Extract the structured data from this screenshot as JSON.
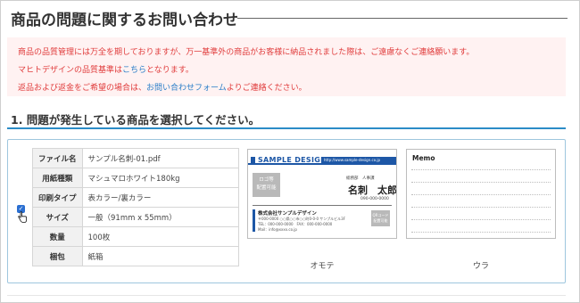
{
  "page": {
    "title": "商品の問題に関するお問い合わせ"
  },
  "notice": {
    "line1": "商品の品質管理には万全を期しておりますが、万一基準外の商品がお客様に納品されました際は、ご遠慮なくご連絡願います。",
    "line2_pre": "マヒトデザインの品質基準は",
    "line2_link": "こちら",
    "line2_post": "となります。",
    "line3_pre": "返品および返金をご希望の場合は、",
    "line3_link": "お問い合わせフォーム",
    "line3_post": "よりご連絡ください。"
  },
  "step": {
    "label": "1. 問題が発生している商品を選択してください。"
  },
  "product": {
    "selected": true,
    "spec": [
      {
        "key": "ファイル名",
        "value": "サンプル名刺-01.pdf"
      },
      {
        "key": "用紙種類",
        "value": "マシュマロホワイト180kg"
      },
      {
        "key": "印刷タイプ",
        "value": "表カラー/裏カラー"
      },
      {
        "key": "サイズ",
        "value": "一般（91mm x 55mm）"
      },
      {
        "key": "数量",
        "value": "100枚"
      },
      {
        "key": "梱包",
        "value": "紙箱"
      }
    ],
    "front_caption": "オモテ",
    "back_caption": "ウラ"
  },
  "card_front": {
    "brand": "SAMPLE DESIGN",
    "url": "http://www.sample-design.co.jp",
    "logo_l1": "ロゴ等",
    "logo_l2": "配置可能",
    "role": "総務部　人事課",
    "name": "名刺　太郎",
    "phone": "090-000-0000",
    "company": "株式会社サンプルデザイン",
    "addr1": "〒000-0000 ○○県○○市○○町0-0-0 サンプルビル3F",
    "addr2": "TEL：000-000-0000　FAX：000-000-0000",
    "addr3": "Mail：info@xxxx.co.jp",
    "qr_l1": "QRコード",
    "qr_l2": "配置可能"
  },
  "card_back": {
    "memo": "Memo"
  },
  "colors": {
    "accent": "#2b8cc7",
    "notice_bg": "#fff2f2",
    "notice_text": "#e03c3c",
    "link": "#2a7ec8",
    "brand_blue": "#1d57a6"
  },
  "icons": {
    "checkbox": "checkbox-checked-icon",
    "cursor": "hand-pointer-icon"
  }
}
